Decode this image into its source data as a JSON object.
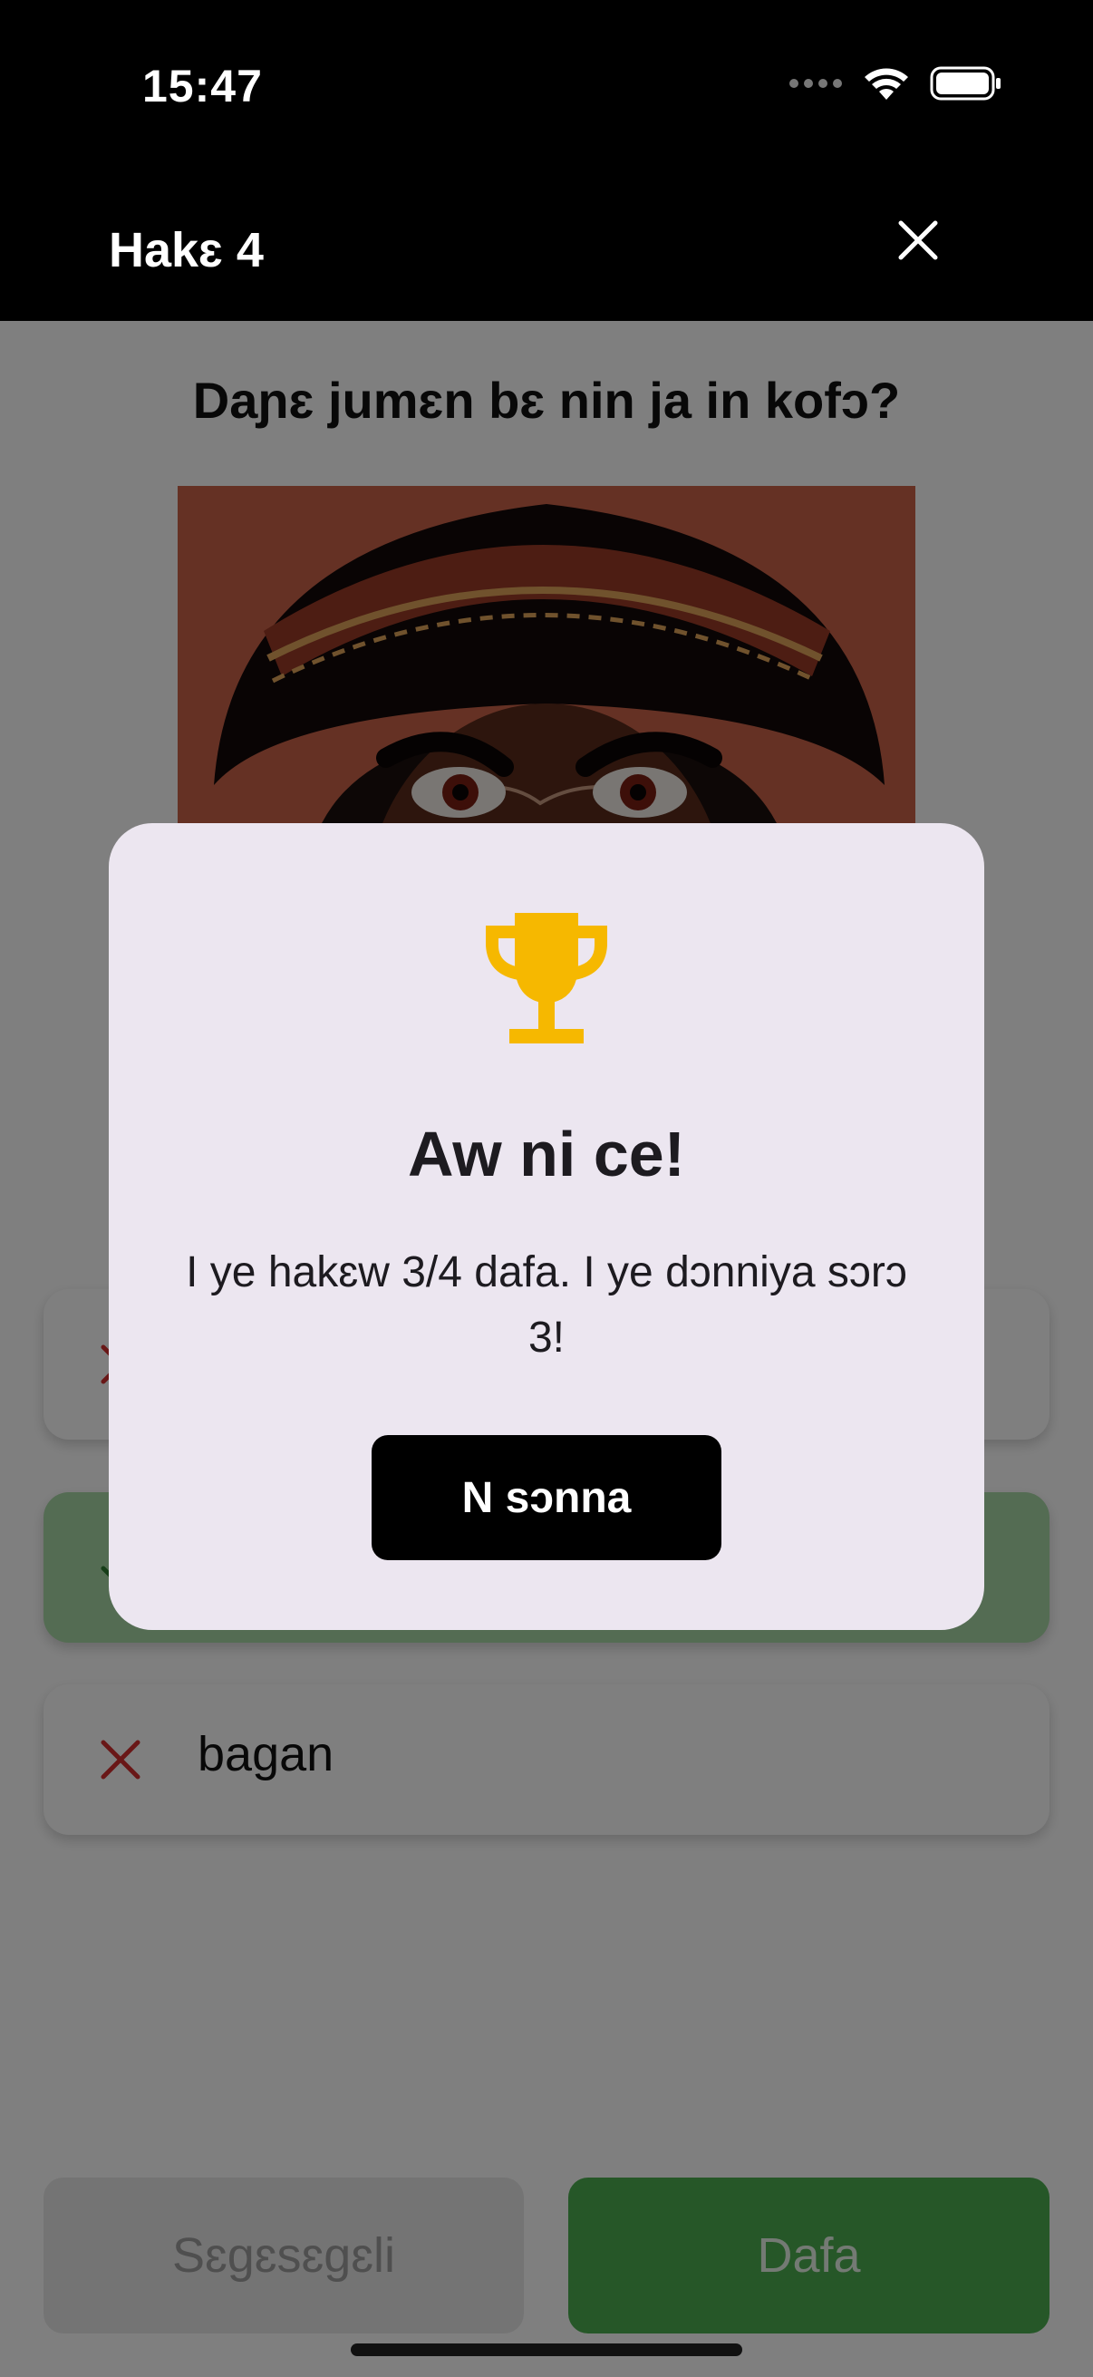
{
  "status": {
    "time": "15:47"
  },
  "appbar": {
    "title": "Hakɛ 4"
  },
  "question": "Daɲɛ jumɛn bɛ nin ja in kofɔ?",
  "options": [
    {
      "label": "",
      "state": "wrong"
    },
    {
      "label": "",
      "state": "correct"
    },
    {
      "label": "bagan",
      "state": "wrong"
    }
  ],
  "buttons": {
    "left": "Sɛgɛsɛgɛli",
    "right": "Dafa"
  },
  "dialog": {
    "title": "Aw ni ce!",
    "body": "I ye hakɛw 3/4 dafa. I ye dɔnniya sɔrɔ 3!",
    "button": "N sɔnna"
  },
  "colors": {
    "trophy": "#f6b800",
    "wrong": "#d32f2f",
    "correct": "#2e7d32",
    "primary": "#4caf50"
  }
}
